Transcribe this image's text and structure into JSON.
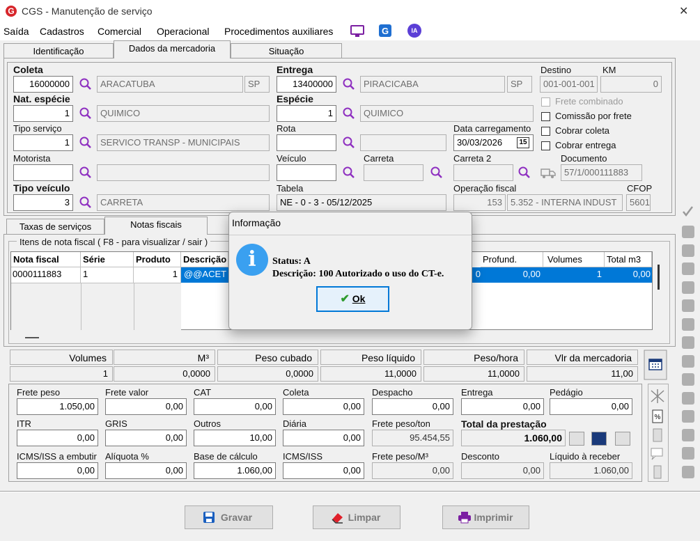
{
  "window": {
    "title": "CGS - Manutenção de serviço"
  },
  "menu": [
    "Saída",
    "Cadastros",
    "Comercial",
    "Operacional",
    "Procedimentos auxiliares"
  ],
  "menu_ia": "IA",
  "tabs": [
    "Identificação",
    "Dados da mercadoria",
    "Situação"
  ],
  "coleta": {
    "label": "Coleta",
    "code": "16000000",
    "city": "ARACATUBA",
    "uf": "SP"
  },
  "entrega": {
    "label": "Entrega",
    "code": "13400000",
    "city": "PIRACICABA",
    "uf": "SP"
  },
  "destino": {
    "label": "Destino",
    "value": "001-001-001"
  },
  "km": {
    "label": "KM",
    "value": "0"
  },
  "nat_especie": {
    "label": "Nat. espécie",
    "code": "1",
    "desc": "QUIMICO"
  },
  "especie": {
    "label": "Espécie",
    "code": "1",
    "desc": "QUIMICO"
  },
  "checks": {
    "frete_combinado": "Frete combinado",
    "comissao": "Comissão por frete",
    "cobrar_coleta": "Cobrar coleta",
    "cobrar_entrega": "Cobrar entrega"
  },
  "tipo_servico": {
    "label": "Tipo serviço",
    "code": "1",
    "desc": "SERVICO TRANSP - MUNICIPAIS"
  },
  "rota": {
    "label": "Rota"
  },
  "data_carregamento": {
    "label": "Data carregamento",
    "value": "30/03/2026",
    "cal_day": "15"
  },
  "motorista": {
    "label": "Motorista"
  },
  "veiculo": {
    "label": "Veículo"
  },
  "carreta": {
    "label": "Carreta"
  },
  "carreta2": {
    "label": "Carreta 2"
  },
  "documento": {
    "label": "Documento",
    "value": "57/1/000111883"
  },
  "tipo_veiculo": {
    "label": "Tipo veículo",
    "code": "3",
    "desc": "CARRETA"
  },
  "tabela": {
    "label": "Tabela",
    "value": "NE - 0 - 3 - 05/12/2025"
  },
  "operacao_fiscal": {
    "label": "Operação fiscal",
    "code": "153",
    "desc": "5.352 - INTERNA INDUST"
  },
  "cfop": {
    "label": "CFOP",
    "value": "5601"
  },
  "subtabs": [
    "Taxas de serviços",
    "Notas fiscais"
  ],
  "itens_title": "Itens de nota fiscal ( F8 - para visualizar / sair )",
  "grid": {
    "headers": [
      "Nota fiscal",
      "Série",
      "Produto",
      "Descrição",
      "Profund.",
      "Volumes",
      "Total m3"
    ],
    "row": [
      "0000111883",
      "1",
      "1",
      "@@ACET",
      "0",
      "0,00",
      "1",
      "0,00"
    ]
  },
  "sum": {
    "headers": [
      "Volumes",
      "M³",
      "Peso cubado",
      "Peso líquido",
      "Peso/hora",
      "Vlr da mercadoria"
    ],
    "values": [
      "1",
      "0,0000",
      "0,0000",
      "11,0000",
      "11,0000",
      "11,00"
    ]
  },
  "fin": {
    "r1": [
      [
        "Frete peso",
        "1.050,00"
      ],
      [
        "Frete valor",
        "0,00"
      ],
      [
        "CAT",
        "0,00"
      ],
      [
        "Coleta",
        "0,00"
      ],
      [
        "Despacho",
        "0,00"
      ],
      [
        "Entrega",
        "0,00"
      ],
      [
        "Pedágio",
        "0,00"
      ]
    ],
    "r2": [
      [
        "ITR",
        "0,00"
      ],
      [
        "GRIS",
        "0,00"
      ],
      [
        "Outros",
        "10,00"
      ],
      [
        "Diária",
        "0,00"
      ],
      [
        "Frete peso/ton",
        "95.454,55"
      ],
      [
        "Total da prestação",
        "1.060,00"
      ]
    ],
    "r3": [
      [
        "ICMS/ISS a embutir",
        "0,00"
      ],
      [
        "Alíquota %",
        "0,00"
      ],
      [
        "Base de cálculo",
        "1.060,00"
      ],
      [
        "ICMS/ISS",
        "0,00"
      ],
      [
        "Frete peso/M³",
        "0,00"
      ],
      [
        "Desconto",
        "0,00"
      ],
      [
        "Líquido à receber",
        "1.060,00"
      ]
    ]
  },
  "buttons": {
    "gravar": "Gravar",
    "limpar": "Limpar",
    "imprimir": "Imprimir"
  },
  "dialog": {
    "title": "Informação",
    "status": "Status: A",
    "descricao": "Descrição: 100 Autorizado o uso do CT-e.",
    "ok": "Ok"
  },
  "colors": {
    "accent": "#0078d7",
    "selection": "#0078d7",
    "brand": "#d7262b"
  }
}
